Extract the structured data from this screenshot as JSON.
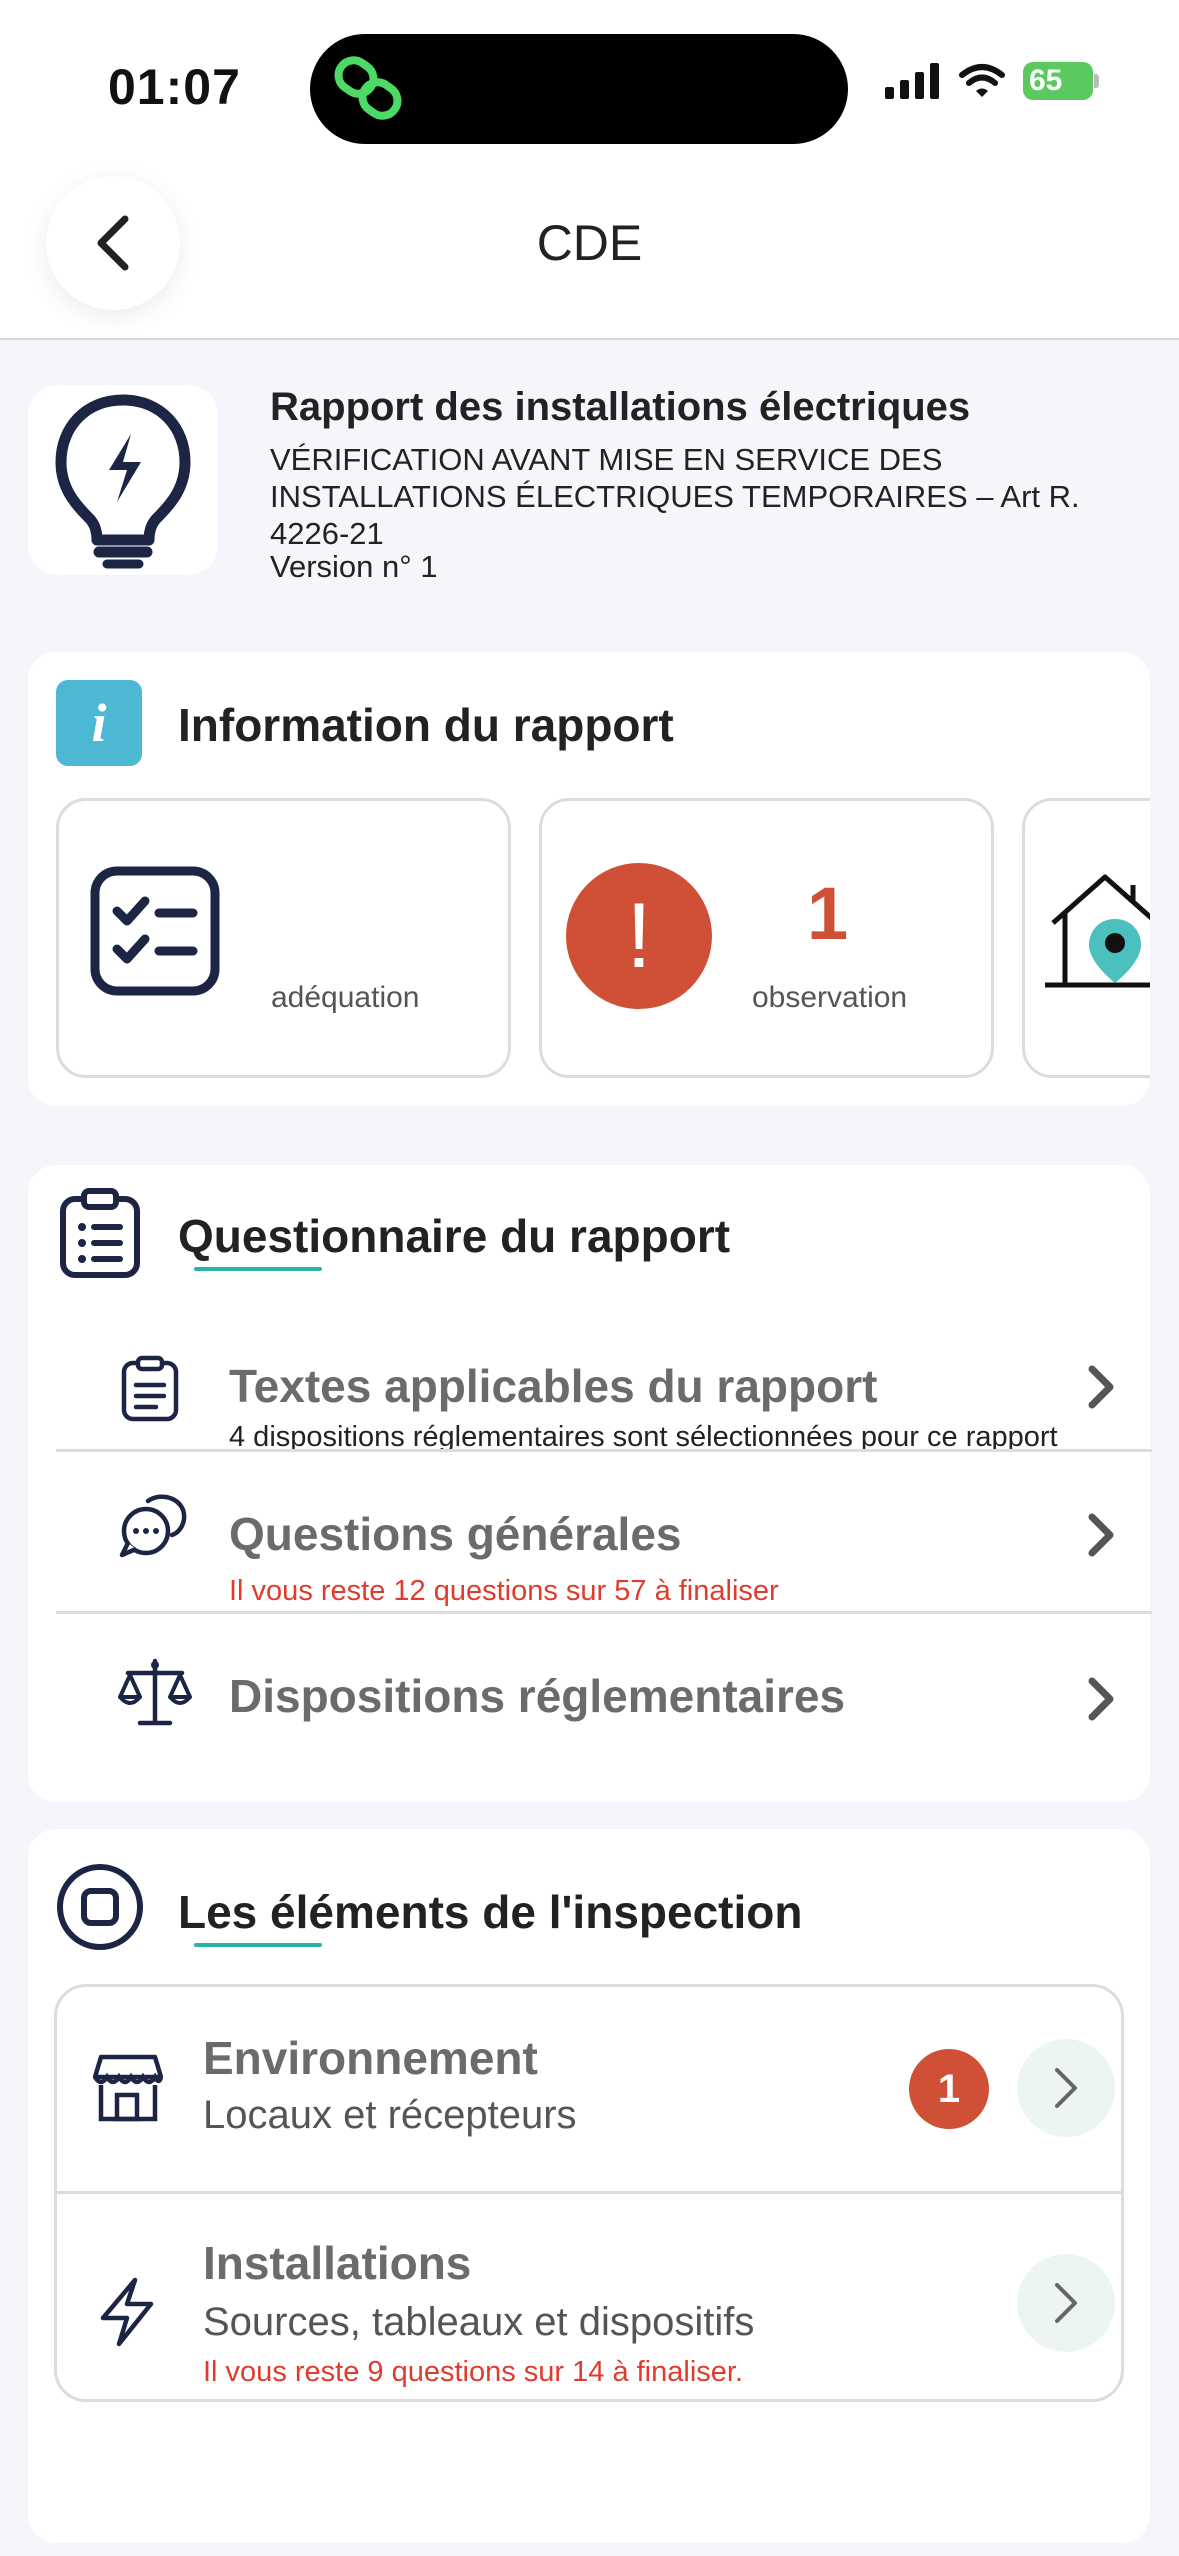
{
  "status_bar": {
    "time": "01:07",
    "battery": "65"
  },
  "nav": {
    "title": "CDE"
  },
  "report": {
    "title": "Rapport des installations électriques",
    "subtitle": "VÉRIFICATION AVANT MISE EN SERVICE DES INSTALLATIONS ÉLECTRIQUES  TEMPORAIRES  – Art R. 4226-21",
    "version": "Version n° 1"
  },
  "info_section": {
    "title": "Information du rapport",
    "badge_letter": "i",
    "tiles": [
      {
        "label": "adéquation",
        "icon": "checklist-icon"
      },
      {
        "count": "1",
        "label": "observation",
        "icon": "alert-icon"
      },
      {
        "icon": "house-location-icon"
      }
    ]
  },
  "questionnaire": {
    "title": "Questionnaire du rapport",
    "items": [
      {
        "title": "Textes applicables du rapport",
        "subtitle": "4 dispositions réglementaires sont sélectionnées pour ce rapport",
        "icon": "clipboard-icon"
      },
      {
        "title": "Questions générales",
        "subtitle": "Il vous reste 12 questions sur 57 à finaliser",
        "icon": "chat-bubbles-icon"
      },
      {
        "title": "Dispositions réglementaires",
        "icon": "scales-icon"
      }
    ]
  },
  "inspection": {
    "title": "Les éléments de l'inspection",
    "items": [
      {
        "title": "Environnement",
        "subtitle": "Locaux et récepteurs",
        "badge": "1",
        "icon": "store-icon"
      },
      {
        "title": "Installations",
        "subtitle": "Sources, tableaux et dispositifs",
        "note": "Il vous reste 9 questions sur 14 à finaliser.",
        "icon": "lightning-icon"
      }
    ]
  },
  "colors": {
    "accent": "#2bb3a6",
    "alert": "#cf5037",
    "info": "#4cb8d4",
    "warning_text": "#e03c2e",
    "icon_dark": "#1d2545"
  }
}
